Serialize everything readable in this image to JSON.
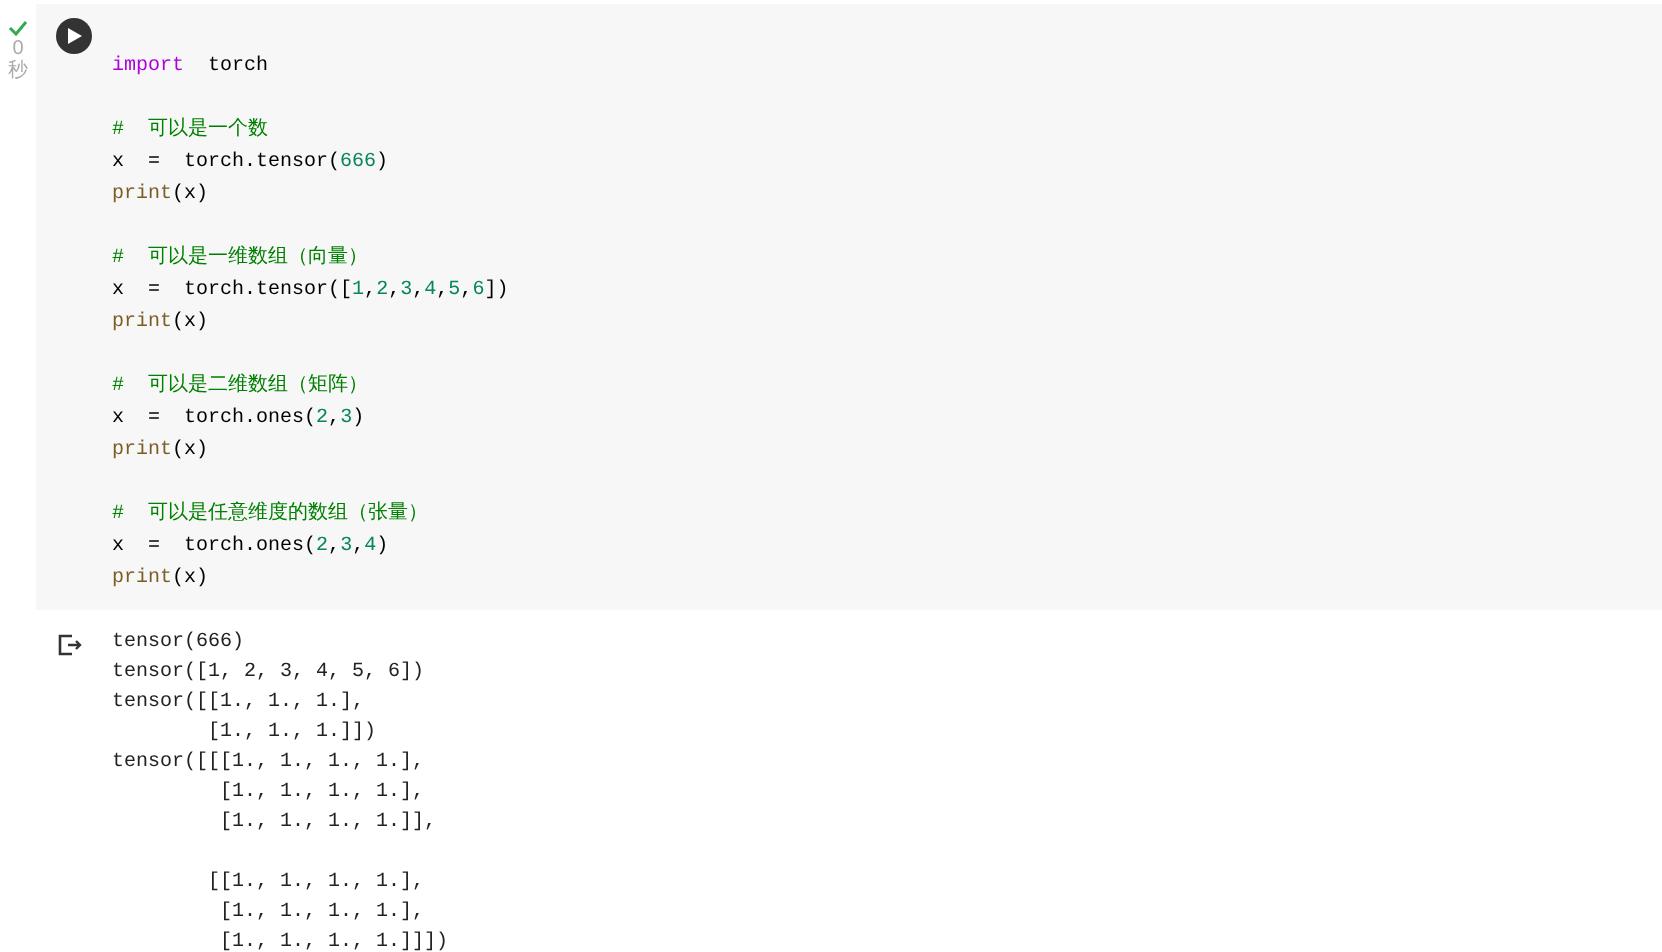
{
  "cell": {
    "status": {
      "done": true,
      "duration": "0",
      "unit": "秒"
    },
    "code_blocks": [
      [
        [
          {
            "kind": "keyword",
            "text": "import"
          },
          {
            "kind": "plain",
            "text": "  torch"
          }
        ]
      ],
      [
        [
          {
            "kind": "comment",
            "text": "#  可以是一个数"
          }
        ],
        [
          {
            "kind": "plain",
            "text": "x  =  torch.tensor("
          },
          {
            "kind": "number",
            "text": "666"
          },
          {
            "kind": "plain",
            "text": ")"
          }
        ],
        [
          {
            "kind": "builtin",
            "text": "print"
          },
          {
            "kind": "plain",
            "text": "(x)"
          }
        ]
      ],
      [
        [
          {
            "kind": "comment",
            "text": "#  可以是一维数组（向量）"
          }
        ],
        [
          {
            "kind": "plain",
            "text": "x  =  torch.tensor(["
          },
          {
            "kind": "number",
            "text": "1"
          },
          {
            "kind": "plain",
            "text": ","
          },
          {
            "kind": "number",
            "text": "2"
          },
          {
            "kind": "plain",
            "text": ","
          },
          {
            "kind": "number",
            "text": "3"
          },
          {
            "kind": "plain",
            "text": ","
          },
          {
            "kind": "number",
            "text": "4"
          },
          {
            "kind": "plain",
            "text": ","
          },
          {
            "kind": "number",
            "text": "5"
          },
          {
            "kind": "plain",
            "text": ","
          },
          {
            "kind": "number",
            "text": "6"
          },
          {
            "kind": "plain",
            "text": "])"
          }
        ],
        [
          {
            "kind": "builtin",
            "text": "print"
          },
          {
            "kind": "plain",
            "text": "(x)"
          }
        ]
      ],
      [
        [
          {
            "kind": "comment",
            "text": "#  可以是二维数组（矩阵）"
          }
        ],
        [
          {
            "kind": "plain",
            "text": "x  =  torch.ones("
          },
          {
            "kind": "number",
            "text": "2"
          },
          {
            "kind": "plain",
            "text": ","
          },
          {
            "kind": "number",
            "text": "3"
          },
          {
            "kind": "plain",
            "text": ")"
          }
        ],
        [
          {
            "kind": "builtin",
            "text": "print"
          },
          {
            "kind": "plain",
            "text": "(x)"
          }
        ]
      ],
      [
        [
          {
            "kind": "comment",
            "text": "#  可以是任意维度的数组（张量）"
          }
        ],
        [
          {
            "kind": "plain",
            "text": "x  =  torch.ones("
          },
          {
            "kind": "number",
            "text": "2"
          },
          {
            "kind": "plain",
            "text": ","
          },
          {
            "kind": "number",
            "text": "3"
          },
          {
            "kind": "plain",
            "text": ","
          },
          {
            "kind": "number",
            "text": "4"
          },
          {
            "kind": "plain",
            "text": ")"
          }
        ],
        [
          {
            "kind": "builtin",
            "text": "print"
          },
          {
            "kind": "plain",
            "text": "(x)"
          }
        ]
      ]
    ],
    "output_blocks": [
      [
        "tensor(666)",
        "tensor([1, 2, 3, 4, 5, 6])",
        "tensor([[1., 1., 1.],",
        "        [1., 1., 1.]])",
        "tensor([[[1., 1., 1., 1.],",
        "         [1., 1., 1., 1.],",
        "         [1., 1., 1., 1.]],"
      ],
      [
        "        [[1., 1., 1., 1.],",
        "         [1., 1., 1., 1.],",
        "         [1., 1., 1., 1.]]])"
      ]
    ]
  }
}
